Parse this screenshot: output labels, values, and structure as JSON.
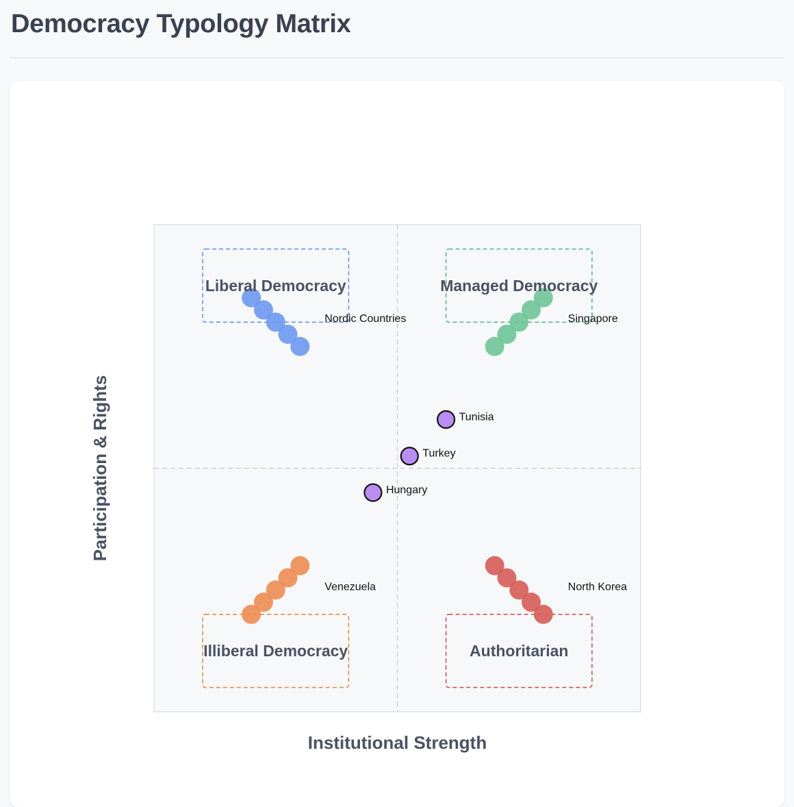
{
  "page": {
    "title": "Democracy Typology Matrix"
  },
  "chart_data": {
    "type": "scatter",
    "title": "",
    "xlabel": "Institutional Strength",
    "ylabel": "Participation & Rights",
    "xlim": [
      0,
      100
    ],
    "ylim": [
      0,
      100
    ],
    "grid": false,
    "reference_lines": {
      "x": 50,
      "y": 50
    },
    "quadrants": [
      {
        "label": "Liberal Democracy",
        "color": "#5b8ee6",
        "x_range": [
          10,
          40
        ],
        "y_range": [
          80,
          95
        ]
      },
      {
        "label": "Managed Democracy",
        "color": "#4cb784",
        "x_range": [
          60,
          90
        ],
        "y_range": [
          80,
          95
        ]
      },
      {
        "label": "Illiberal Democracy",
        "color": "#e8833a",
        "x_range": [
          10,
          40
        ],
        "y_range": [
          5,
          20
        ]
      },
      {
        "label": "Authoritarian",
        "color": "#cc4a44",
        "x_range": [
          60,
          90
        ],
        "y_range": [
          5,
          20
        ]
      }
    ],
    "series": [
      {
        "color": "#6b98ee",
        "label": "Nordic Countries",
        "points": [
          [
            20,
            85
          ],
          [
            22.5,
            82.5
          ],
          [
            25,
            80
          ],
          [
            27.5,
            77.5
          ],
          [
            30,
            75
          ]
        ]
      },
      {
        "color": "#6dc497",
        "label": "Singapore",
        "points": [
          [
            70,
            75
          ],
          [
            72.5,
            77.5
          ],
          [
            75,
            80
          ],
          [
            77.5,
            82.5
          ],
          [
            80,
            85
          ]
        ]
      },
      {
        "color": "#ed8c52",
        "label": "Venezuela",
        "points": [
          [
            20,
            20
          ],
          [
            22.5,
            22.5
          ],
          [
            25,
            25
          ],
          [
            27.5,
            27.5
          ],
          [
            30,
            30
          ]
        ]
      },
      {
        "color": "#d65c56",
        "label": "North Korea",
        "points": [
          [
            70,
            30
          ],
          [
            72.5,
            27.5
          ],
          [
            75,
            25
          ],
          [
            77.5,
            22.5
          ],
          [
            80,
            20
          ]
        ]
      }
    ],
    "transitional": {
      "color": "#b98ef0",
      "stroke": "#111111",
      "points": [
        {
          "name": "Tunisia",
          "x": 60,
          "y": 60
        },
        {
          "name": "Turkey",
          "x": 52.5,
          "y": 52.5
        },
        {
          "name": "Hungary",
          "x": 45,
          "y": 45
        }
      ]
    }
  }
}
